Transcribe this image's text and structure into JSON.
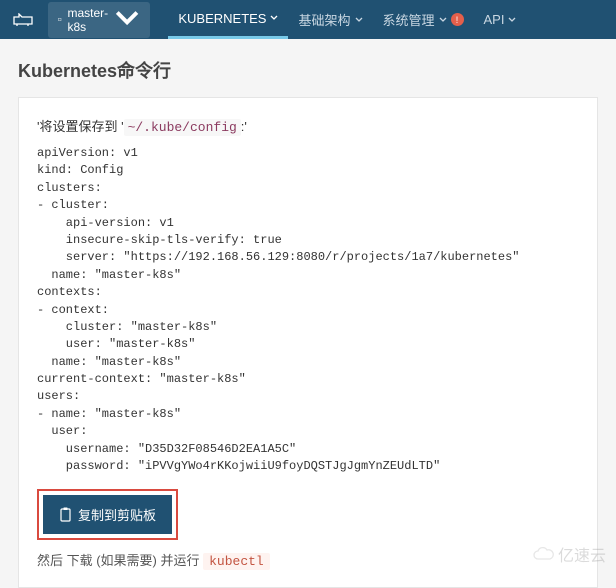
{
  "navbar": {
    "project_name": "master-k8s",
    "items": [
      {
        "label": "KUBERNETES",
        "active": true
      },
      {
        "label": "基础架构",
        "active": false
      },
      {
        "label": "系统管理",
        "active": false,
        "alert": true
      },
      {
        "label": "API",
        "active": false
      }
    ]
  },
  "page_title": "Kubernetes命令行",
  "note": {
    "prefix": "'将设置保存到 '",
    "path": "~/.kube/config",
    "suffix": ":'"
  },
  "config_text": "apiVersion: v1\nkind: Config\nclusters:\n- cluster:\n    api-version: v1\n    insecure-skip-tls-verify: true\n    server: \"https://192.168.56.129:8080/r/projects/1a7/kubernetes\"\n  name: \"master-k8s\"\ncontexts:\n- context:\n    cluster: \"master-k8s\"\n    user: \"master-k8s\"\n  name: \"master-k8s\"\ncurrent-context: \"master-k8s\"\nusers:\n- name: \"master-k8s\"\n  user:\n    username: \"D35D32F08546D2EA1A5C\"\n    password: \"iPVVgYWo4rKKojwiiU9foyDQSTJgJgmYnZEUdLTD\"",
  "copy_btn_label": "复制到剪贴板",
  "footer": {
    "text_before": "然后 下载 (如果需要) 并运行 ",
    "code": "kubectl"
  },
  "watermark_text": "亿速云"
}
